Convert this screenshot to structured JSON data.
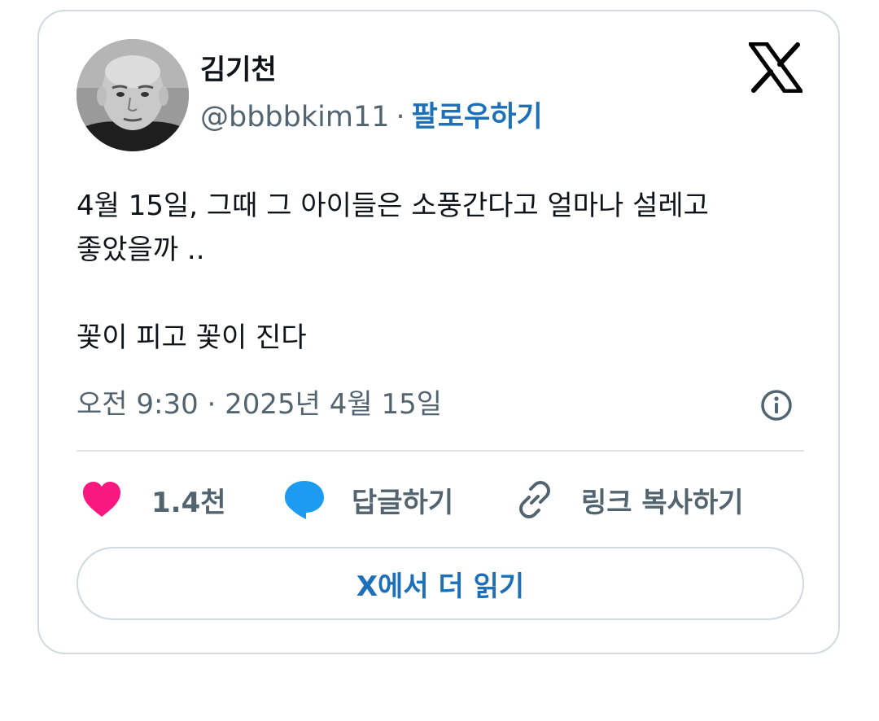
{
  "author": {
    "name": "김기천",
    "handle": "@bbbbkim11",
    "separator": "·",
    "follow_label": "팔로우하기",
    "avatar_icon": "profile-photo"
  },
  "platform": {
    "logo_icon": "x-logo"
  },
  "tweet": {
    "lines": [
      "4월 15일, 그때 그 아이들은 소풍간다고 얼마나 설레고",
      "좋았을까 ..",
      "",
      "꽃이 피고 꽃이 진다"
    ],
    "timestamp": "오전 9:30 · 2025년 4월 15일"
  },
  "actions": {
    "like_count": "1.4천",
    "reply_label": "답글하기",
    "copy_link_label": "링크 복사하기"
  },
  "read_more_label": "X에서 더 읽기",
  "colors": {
    "accent": "#1d6fb8",
    "like": "#f91880",
    "reply": "#1d9bf0",
    "muted": "#536471",
    "border": "#cfd9de"
  }
}
